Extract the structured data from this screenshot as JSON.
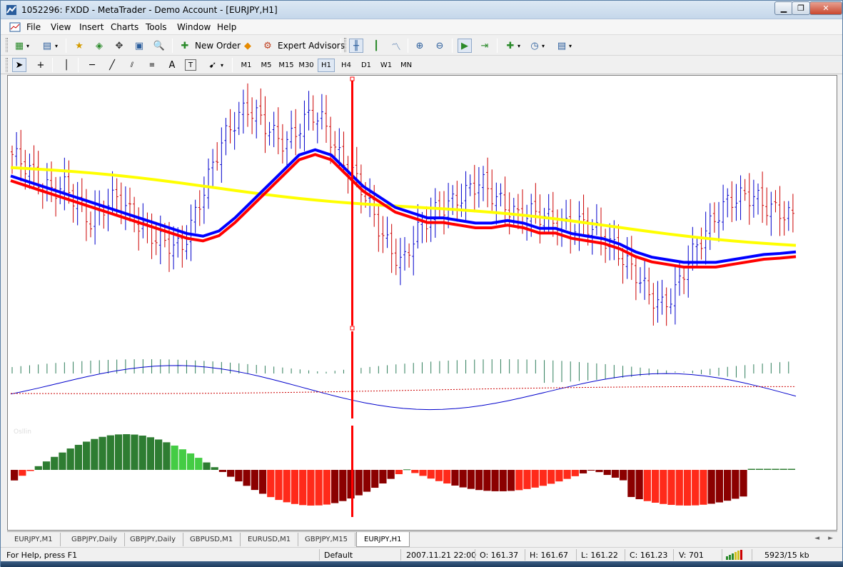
{
  "window": {
    "title": "1052296: FXDD - MetaTrader - Demo Account - [EURJPY,H1]"
  },
  "menu": [
    "File",
    "View",
    "Insert",
    "Charts",
    "Tools",
    "Window",
    "Help"
  ],
  "toolbar": {
    "new_order": "New Order",
    "expert_advisors": "Expert Advisors"
  },
  "drawing_tools": [
    "A"
  ],
  "timeframes": [
    "M1",
    "M5",
    "M15",
    "M30",
    "H1",
    "H4",
    "D1",
    "W1",
    "MN"
  ],
  "active_timeframe": "H1",
  "chart_tabs": [
    "EURJPY,M1",
    "GBPJPY,Daily",
    "GBPJPY,Daily",
    "GBPUSD,M1",
    "EURUSD,M1",
    "GBPJPY,M15",
    "EURJPY,H1"
  ],
  "active_tab": "EURJPY,H1",
  "status": {
    "help": "For Help, press F1",
    "profile": "Default",
    "time": "2007.11.21 22:00",
    "open": "O: 161.37",
    "high": "H: 161.67",
    "low": "L: 161.22",
    "close": "C: 161.23",
    "volume": "V: 701",
    "traffic": "5923/15 kb"
  },
  "indicator_label": "Osllin",
  "colors": {
    "bull_bar": "#0000cc",
    "bear_bar": "#cc0000",
    "ma_fast": "#ff0000",
    "ma_mid": "#0000ff",
    "ma_slow": "#ffff00",
    "crosshair": "#ff0000",
    "hist_green": "#2e7d32",
    "hist_red": "#ff2a1a",
    "hist_darkred": "#8b0000"
  },
  "chart_data": {
    "type": "line",
    "symbol": "EURJPY",
    "timeframe": "H1",
    "price_close": [
      163.6,
      163.4,
      163.1,
      162.9,
      163.0,
      162.7,
      162.3,
      162.6,
      162.8,
      162.5,
      162.2,
      162.0,
      161.9,
      161.8,
      162.4,
      163.1,
      163.8,
      164.2,
      164.5,
      164.3,
      164.0,
      163.8,
      164.1,
      164.4,
      164.2,
      163.6,
      163.3,
      162.9,
      162.3,
      161.8,
      161.5,
      162.1,
      162.4,
      162.6,
      162.7,
      162.9,
      163.1,
      162.8,
      162.6,
      162.4,
      162.5,
      162.4,
      162.3,
      162.2,
      162.3,
      162.1,
      161.9,
      161.6,
      161.3,
      160.9,
      160.7,
      161.0,
      161.6,
      162.0,
      162.4,
      162.7,
      162.8,
      162.8,
      162.6,
      162.5,
      162.4
    ],
    "ma_red": [
      163.1,
      163.0,
      162.9,
      162.8,
      162.7,
      162.6,
      162.5,
      162.4,
      162.3,
      162.2,
      162.1,
      162.0,
      161.95,
      162.05,
      162.3,
      162.6,
      162.9,
      163.2,
      163.5,
      163.6,
      163.5,
      163.2,
      162.9,
      162.7,
      162.5,
      162.4,
      162.3,
      162.3,
      162.25,
      162.2,
      162.2,
      162.25,
      162.2,
      162.1,
      162.1,
      162.0,
      161.95,
      161.9,
      161.8,
      161.65,
      161.55,
      161.5,
      161.45,
      161.45,
      161.45,
      161.5,
      161.55,
      161.6,
      161.62,
      161.65
    ]
  }
}
